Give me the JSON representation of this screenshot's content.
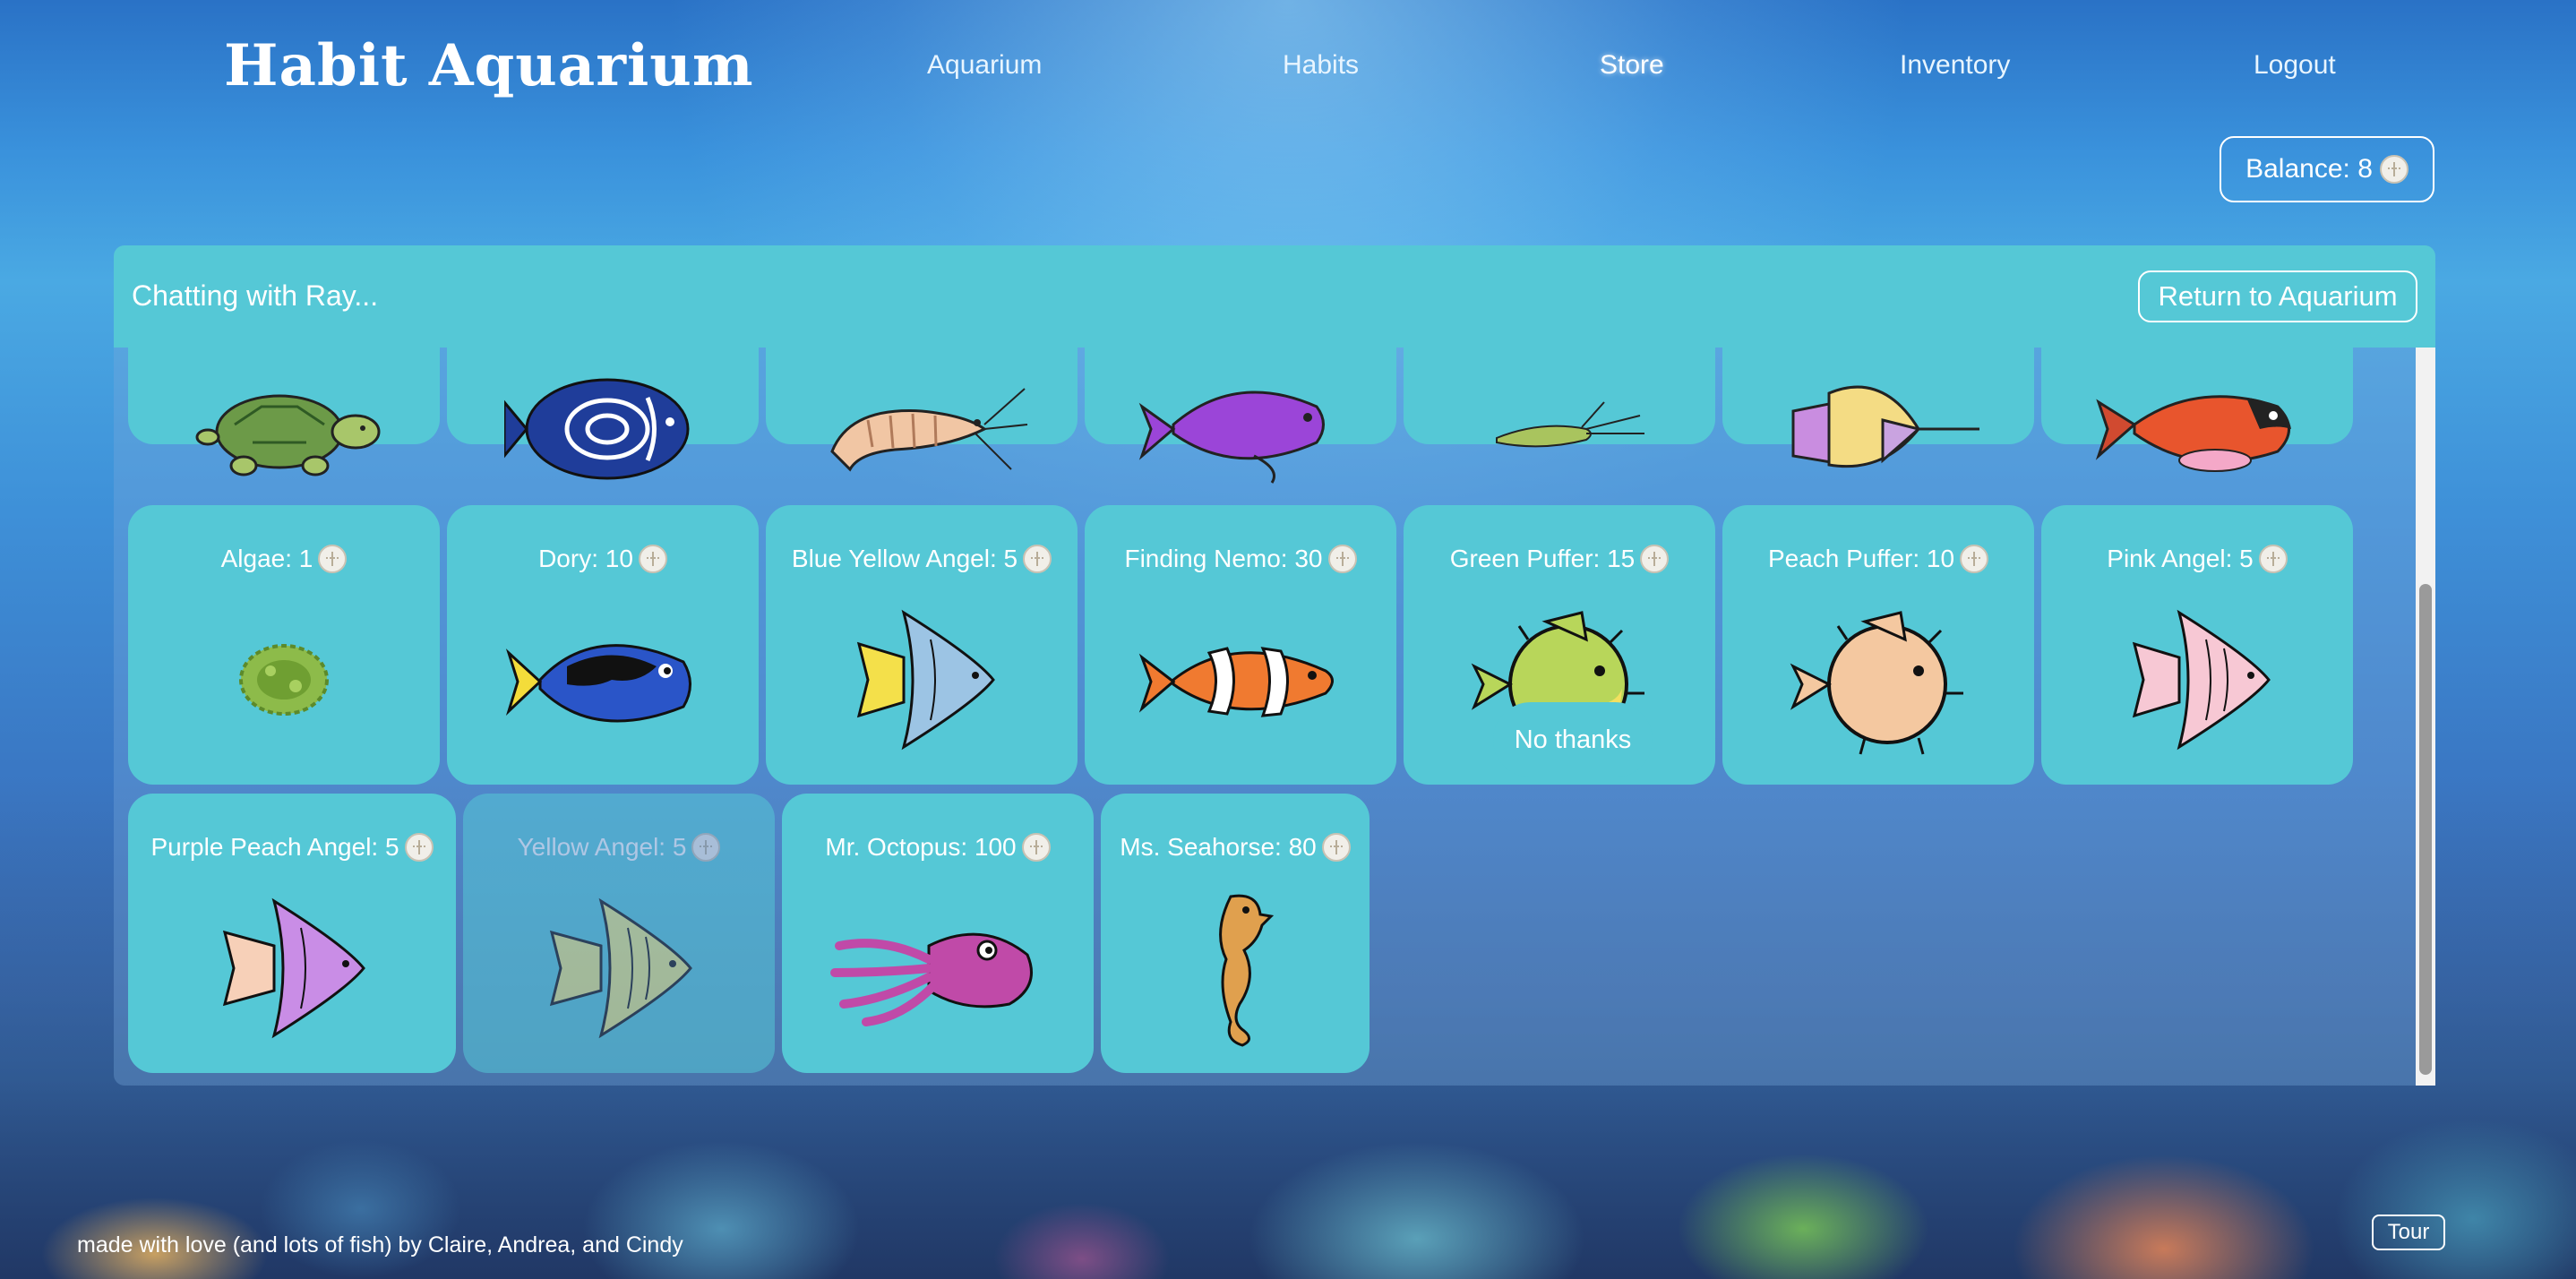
{
  "app": {
    "title": "Habit Aquarium"
  },
  "nav": {
    "items": [
      {
        "label": "Aquarium"
      },
      {
        "label": "Habits"
      },
      {
        "label": "Store"
      },
      {
        "label": "Inventory"
      },
      {
        "label": "Logout"
      }
    ],
    "active": "Store"
  },
  "balance": {
    "label": "Balance: 8",
    "icon": "sand-dollar-icon"
  },
  "dialog": {
    "title": "Chatting with Ray...",
    "return_label": "Return to Aquarium",
    "top_row": [
      {
        "name": "turtle"
      },
      {
        "name": "blue-angel"
      },
      {
        "name": "shrimp"
      },
      {
        "name": "purple-fish"
      },
      {
        "name": "small-green-fish"
      },
      {
        "name": "swordfish"
      },
      {
        "name": "red-fish"
      }
    ],
    "items_row2": [
      {
        "label": "Algae: 1"
      },
      {
        "label": "Dory: 10"
      },
      {
        "label": "Blue Yellow Angel: 5"
      },
      {
        "label": "Finding Nemo: 30"
      },
      {
        "label": "Green Puffer: 15"
      },
      {
        "label": "Peach Puffer: 10"
      },
      {
        "label": "Pink Angel: 5"
      }
    ],
    "items_row3": [
      {
        "label": "Purple Peach Angel: 5"
      },
      {
        "label": "Yellow Angel: 5"
      },
      {
        "label": "Mr. Octopus: 100"
      },
      {
        "label": "Ms. Seahorse: 80"
      }
    ],
    "no_thanks_label": "No thanks"
  },
  "footer": {
    "credit": "made with love (and lots of fish) by Claire, Andrea, and Cindy",
    "tour_label": "Tour"
  },
  "colors": {
    "card": "#55c8d6",
    "header_bar": "#55c8d6",
    "text": "#ffffff"
  }
}
